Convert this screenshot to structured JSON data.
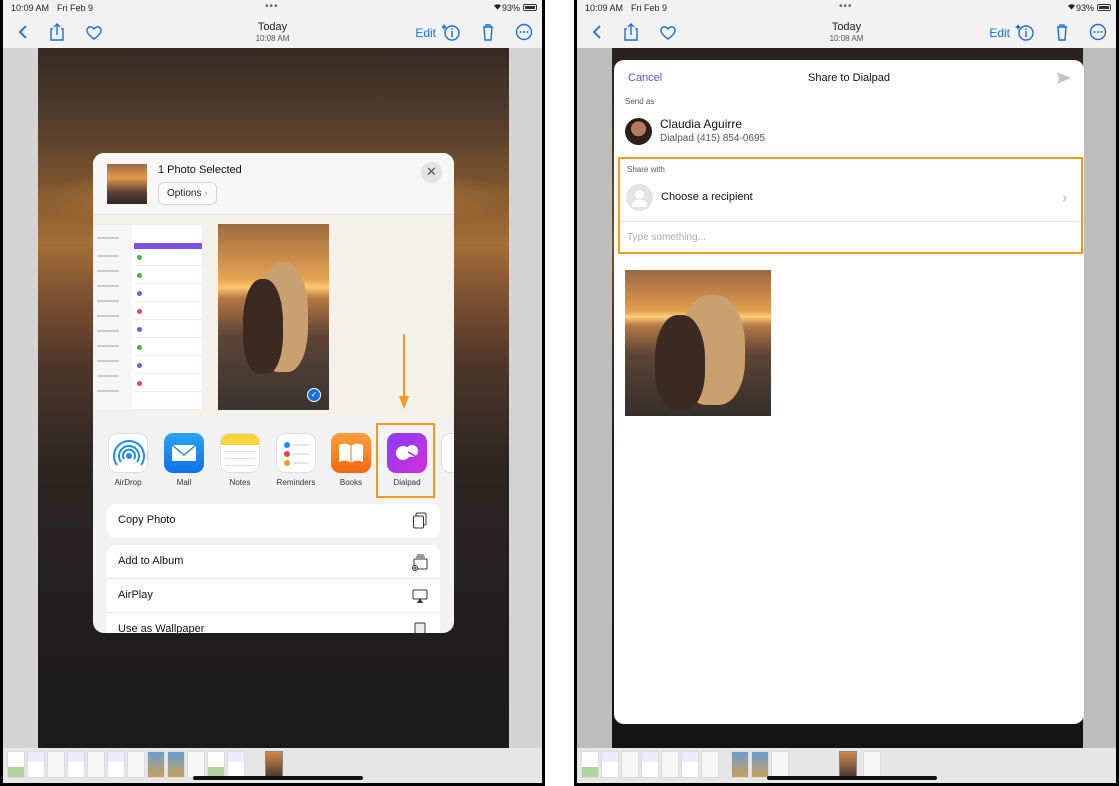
{
  "status": {
    "time": "10:09 AM",
    "date": "Fri Feb 9",
    "battery": "93%"
  },
  "nav": {
    "title": "Today",
    "subtitle": "10:08 AM",
    "edit": "Edit"
  },
  "share_sheet": {
    "selected_count": "1 Photo Selected",
    "options_label": "Options",
    "close_glyph": "✕",
    "apps": [
      {
        "label": "AirDrop",
        "icon": "airdrop-icon"
      },
      {
        "label": "Mail",
        "icon": "mail-icon"
      },
      {
        "label": "Notes",
        "icon": "notes-icon"
      },
      {
        "label": "Reminders",
        "icon": "reminders-icon"
      },
      {
        "label": "Books",
        "icon": "books-icon"
      },
      {
        "label": "Dialpad",
        "icon": "dialpad-icon"
      }
    ],
    "actions_1": [
      {
        "label": "Copy Photo",
        "icon": "copy-icon"
      }
    ],
    "actions_2": [
      {
        "label": "Add to Album",
        "icon": "add-album-icon"
      },
      {
        "label": "AirPlay",
        "icon": "airplay-icon"
      },
      {
        "label": "Use as Wallpaper",
        "icon": "wallpaper-icon"
      }
    ]
  },
  "dialpad_share": {
    "cancel": "Cancel",
    "title": "Share to Dialpad",
    "send_as_label": "Send as",
    "user_name": "Claudia  Aguirre",
    "user_number": "Dialpad (415) 854-0695",
    "share_with_label": "Share with",
    "recipient_placeholder": "Choose a recipient",
    "message_placeholder": "Type something..."
  },
  "colors": {
    "ios_blue": "#1a6fe0",
    "dialpad_purple": "#6a4ce6",
    "highlight_orange": "#f39a1e"
  }
}
